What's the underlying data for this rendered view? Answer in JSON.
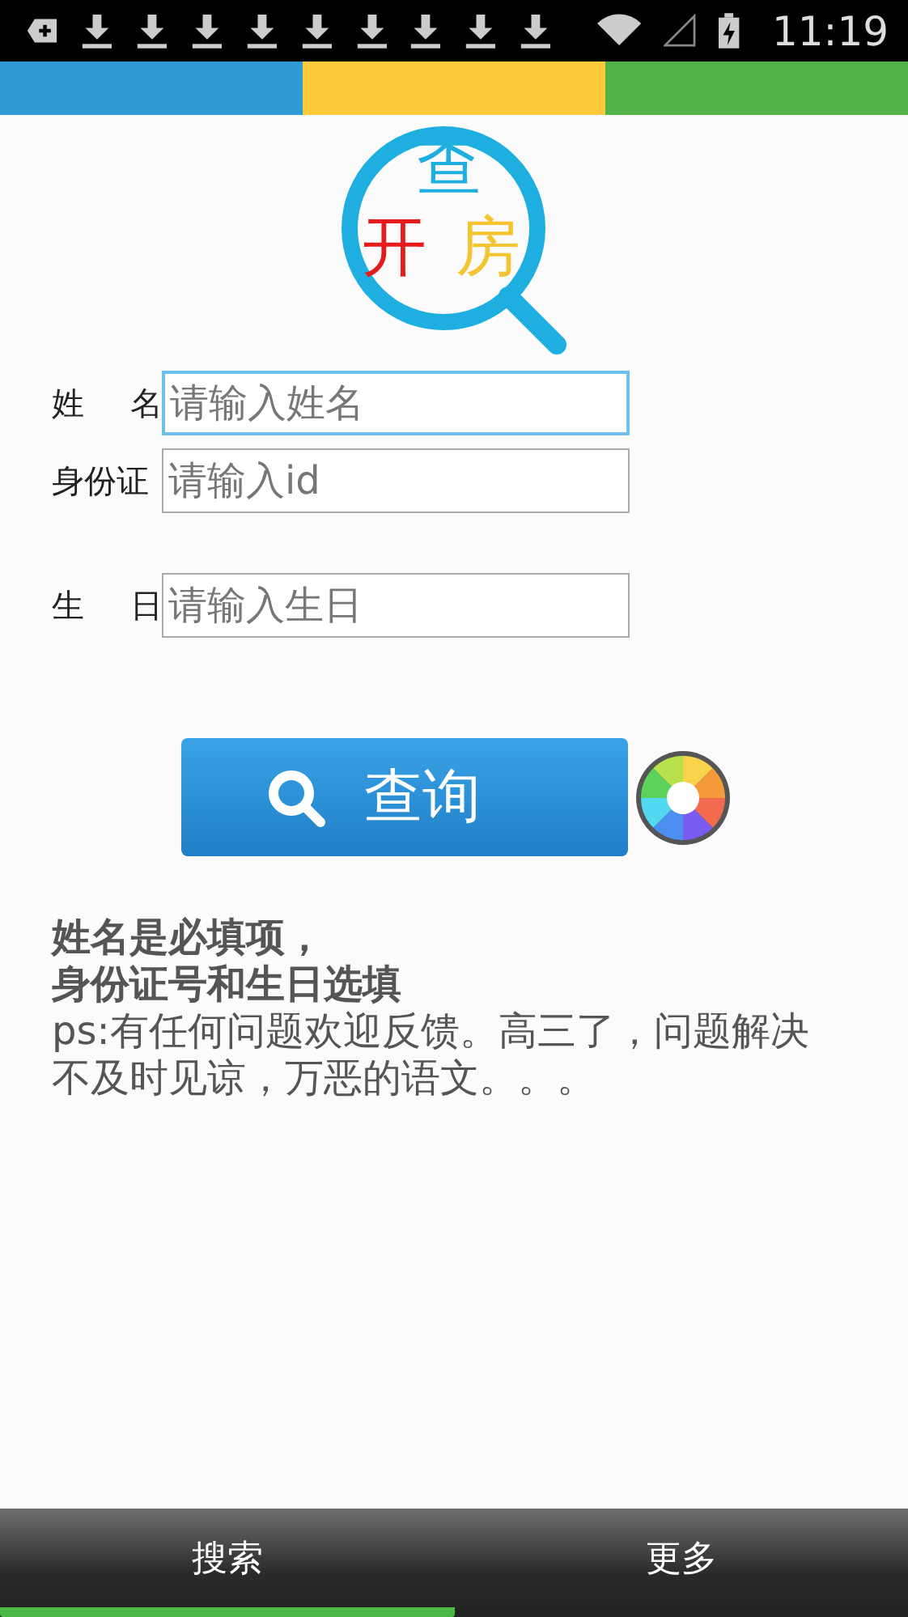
{
  "status_bar": {
    "time": "11:19"
  },
  "color_strip": [
    {
      "color": "#2e9ad6"
    },
    {
      "color": "#fbc93a"
    },
    {
      "color": "#52b24a"
    }
  ],
  "logo": {
    "chars": [
      {
        "text": "查",
        "color": "#1eaee0"
      },
      {
        "text": "开",
        "color": "#e61c1c"
      },
      {
        "text": "房",
        "color": "#f5c431"
      }
    ]
  },
  "form": {
    "fields": [
      {
        "label": "姓 名",
        "placeholder": "请输入姓名",
        "focused": true
      },
      {
        "label": "身份证",
        "placeholder": "请输入id",
        "focused": false
      },
      {
        "label": "生 日",
        "placeholder": "请输入生日",
        "focused": false
      }
    ]
  },
  "search_button": {
    "label": "查询"
  },
  "notes": {
    "bold_lines": [
      "姓名是必填项，",
      "身份证号和生日选填"
    ],
    "text": "ps:有任何问题欢迎反馈。高三了，问题解决不及时见谅，万恶的语文。。。"
  },
  "tabs": [
    {
      "label": "搜索",
      "selected": true
    },
    {
      "label": "更多",
      "selected": false
    }
  ]
}
